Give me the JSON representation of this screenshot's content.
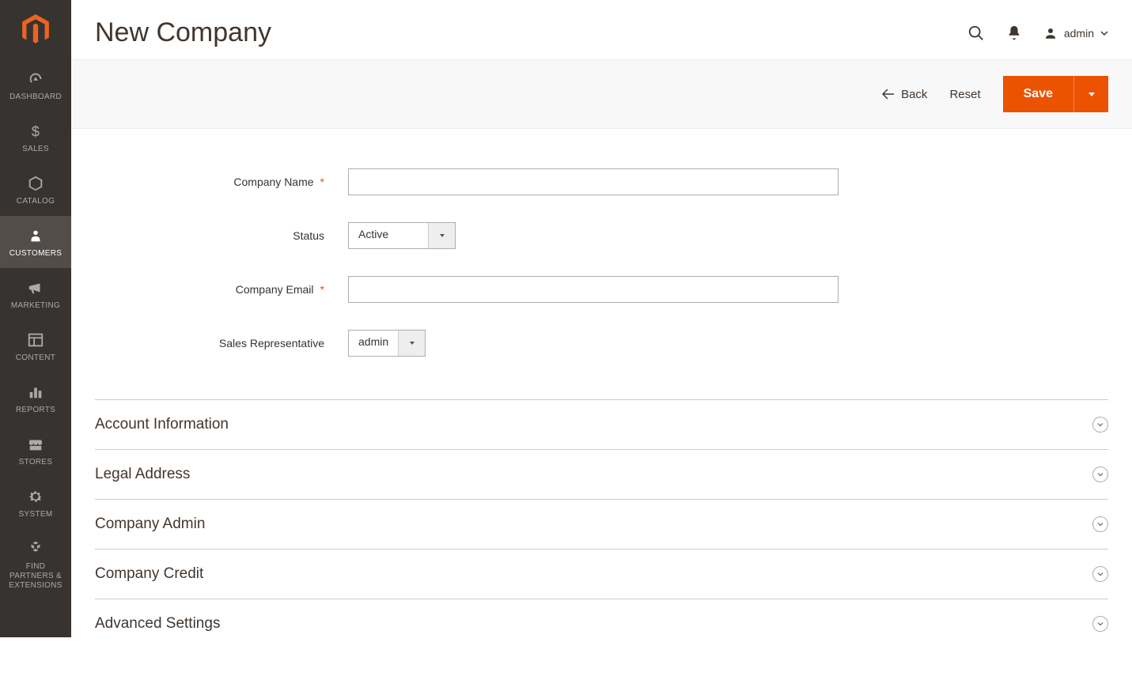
{
  "sidebar": {
    "items": [
      {
        "label": "DASHBOARD",
        "icon": "gauge"
      },
      {
        "label": "SALES",
        "icon": "dollar"
      },
      {
        "label": "CATALOG",
        "icon": "box"
      },
      {
        "label": "CUSTOMERS",
        "icon": "person",
        "active": true
      },
      {
        "label": "MARKETING",
        "icon": "megaphone"
      },
      {
        "label": "CONTENT",
        "icon": "layout"
      },
      {
        "label": "REPORTS",
        "icon": "bars"
      },
      {
        "label": "STORES",
        "icon": "storefront"
      },
      {
        "label": "SYSTEM",
        "icon": "gear"
      },
      {
        "label": "FIND PARTNERS & EXTENSIONS",
        "icon": "blocks"
      }
    ]
  },
  "header": {
    "title": "New Company",
    "user": "admin"
  },
  "actions": {
    "back": "Back",
    "reset": "Reset",
    "save": "Save"
  },
  "form": {
    "company_name": {
      "label": "Company Name",
      "required": true,
      "value": ""
    },
    "status": {
      "label": "Status",
      "required": false,
      "value": "Active"
    },
    "company_email": {
      "label": "Company Email",
      "required": true,
      "value": ""
    },
    "sales_rep": {
      "label": "Sales Representative",
      "required": false,
      "value": "admin"
    }
  },
  "sections": [
    {
      "title": "Account Information"
    },
    {
      "title": "Legal Address"
    },
    {
      "title": "Company Admin"
    },
    {
      "title": "Company Credit"
    },
    {
      "title": "Advanced Settings"
    }
  ]
}
